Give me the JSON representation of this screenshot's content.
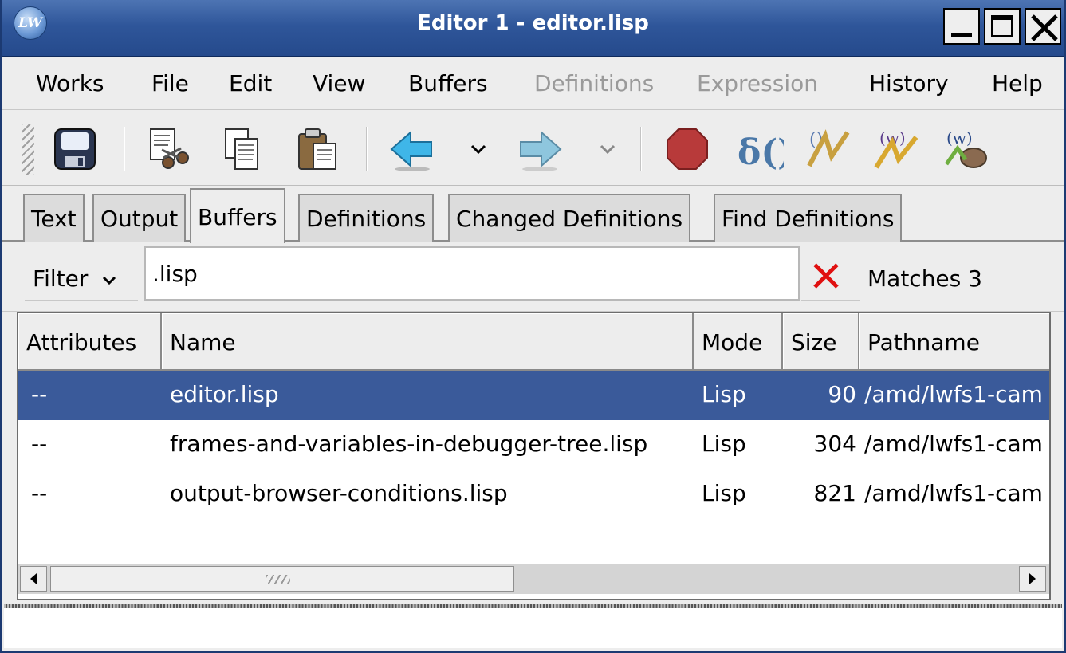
{
  "window": {
    "title": "Editor 1 - editor.lisp",
    "app_icon_text": "LW"
  },
  "menu": {
    "items": [
      {
        "label": "Works",
        "enabled": true
      },
      {
        "label": "File",
        "enabled": true
      },
      {
        "label": "Edit",
        "enabled": true
      },
      {
        "label": "View",
        "enabled": true
      },
      {
        "label": "Buffers",
        "enabled": true
      },
      {
        "label": "Definitions",
        "enabled": false
      },
      {
        "label": "Expression",
        "enabled": false
      },
      {
        "label": "History",
        "enabled": true
      },
      {
        "label": "Help",
        "enabled": true
      }
    ]
  },
  "toolbar": {
    "buttons": [
      "save-icon",
      "cut-icon",
      "copy-icon",
      "paste-icon",
      "back-arrow-icon",
      "back-history-dropdown-icon",
      "forward-arrow-icon",
      "forward-history-dropdown-icon",
      "stop-icon",
      "evaluate-definition-icon",
      "compile-icon",
      "compile-buffer-icon",
      "compile-and-load-icon"
    ]
  },
  "tabs": {
    "items": [
      {
        "label": "Text",
        "active": false
      },
      {
        "label": "Output",
        "active": false
      },
      {
        "label": "Buffers",
        "active": true
      },
      {
        "label": "Definitions",
        "active": false
      },
      {
        "label": "Changed Definitions",
        "active": false
      },
      {
        "label": "Find Definitions",
        "active": false
      }
    ]
  },
  "filter": {
    "label": "Filter",
    "value": ".lisp",
    "matches_text": "Matches 3"
  },
  "table": {
    "columns": [
      "Attributes",
      "Name",
      "Mode",
      "Size",
      "Pathname"
    ],
    "rows": [
      {
        "attributes": "--",
        "name": "editor.lisp",
        "mode": "Lisp",
        "size": "90",
        "pathname": "/amd/lwfs1-cam",
        "selected": true
      },
      {
        "attributes": "--",
        "name": "frames-and-variables-in-debugger-tree.lisp",
        "mode": "Lisp",
        "size": "304",
        "pathname": "/amd/lwfs1-cam",
        "selected": false
      },
      {
        "attributes": "--",
        "name": "output-browser-conditions.lisp",
        "mode": "Lisp",
        "size": "821",
        "pathname": "/amd/lwfs1-cam",
        "selected": false
      }
    ]
  },
  "colors": {
    "titlebar": "#2f569a",
    "selection": "#3a5a9a",
    "clear_x": "#e01010"
  }
}
